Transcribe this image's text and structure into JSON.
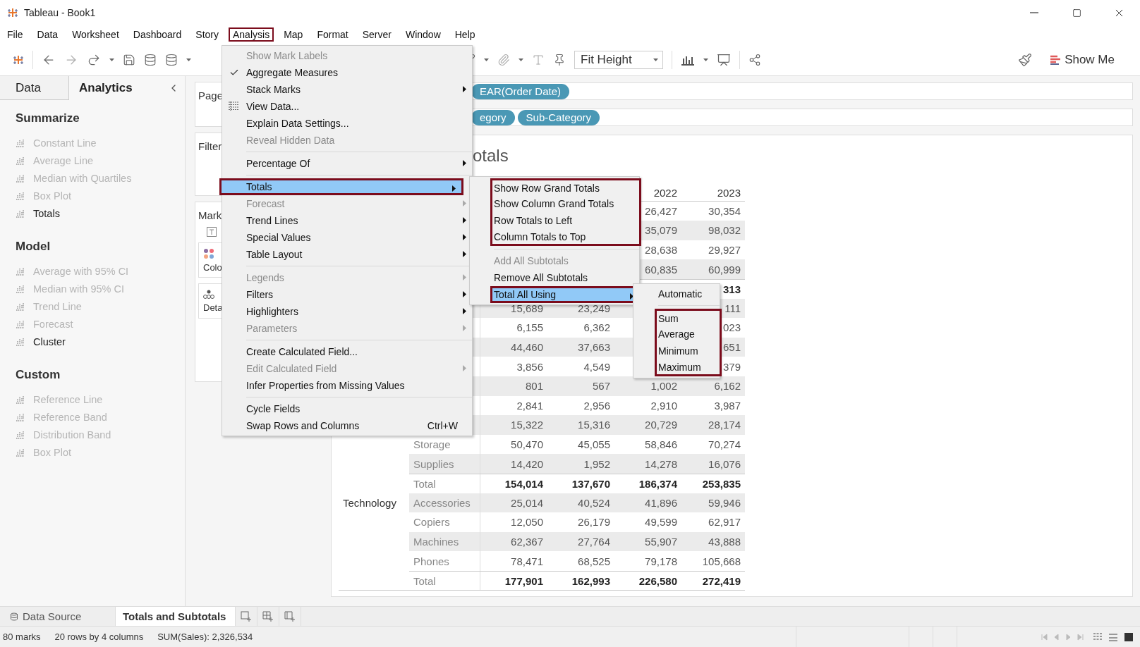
{
  "window": {
    "title": "Tableau - Book1"
  },
  "menu_bar": [
    {
      "label": "File",
      "framed": false
    },
    {
      "label": "Data",
      "framed": false
    },
    {
      "label": "Worksheet",
      "framed": false
    },
    {
      "label": "Dashboard",
      "framed": false
    },
    {
      "label": "Story",
      "framed": false
    },
    {
      "label": "Analysis",
      "framed": true
    },
    {
      "label": "Map",
      "framed": false
    },
    {
      "label": "Format",
      "framed": false
    },
    {
      "label": "Server",
      "framed": false
    },
    {
      "label": "Window",
      "framed": false
    },
    {
      "label": "Help",
      "framed": false
    }
  ],
  "toolbar": {
    "fit": "Fit Height",
    "show_me": "Show Me"
  },
  "side_tabs": [
    {
      "label": "Data",
      "selected": false
    },
    {
      "label": "Analytics",
      "selected": true
    }
  ],
  "analytics": [
    {
      "title": "Summarize",
      "items": [
        {
          "label": "Constant Line",
          "disabled": true
        },
        {
          "label": "Average Line",
          "disabled": true
        },
        {
          "label": "Median with Quartiles",
          "disabled": true
        },
        {
          "label": "Box Plot",
          "disabled": true
        },
        {
          "label": "Totals",
          "disabled": false
        }
      ]
    },
    {
      "title": "Model",
      "items": [
        {
          "label": "Average with 95% CI",
          "disabled": true
        },
        {
          "label": "Median with 95% CI",
          "disabled": true
        },
        {
          "label": "Trend Line",
          "disabled": true
        },
        {
          "label": "Forecast",
          "disabled": true
        },
        {
          "label": "Cluster",
          "disabled": false
        }
      ]
    },
    {
      "title": "Custom",
      "items": [
        {
          "label": "Reference Line",
          "disabled": true
        },
        {
          "label": "Reference Band",
          "disabled": true
        },
        {
          "label": "Distribution Band",
          "disabled": true
        },
        {
          "label": "Box Plot",
          "disabled": true
        }
      ]
    }
  ],
  "cards": {
    "pages": "Page",
    "filters": "Filter",
    "marks": "Mark",
    "mark_buttons": [
      "Colo",
      "Deta"
    ]
  },
  "columns_shelf": [
    "EAR(Order Date)"
  ],
  "rows_shelf": [
    "egory",
    "Sub-Category"
  ],
  "view": {
    "title": "otals",
    "header": {
      "column_3": "2022",
      "column_4": "2023"
    },
    "rows": [
      {
        "total": false,
        "shaded": false,
        "column_3": "26,427",
        "column_4": "30,354"
      },
      {
        "total": false,
        "shaded": true,
        "column_3": "35,079",
        "column_4": "98,032"
      },
      {
        "total": false,
        "shaded": false,
        "column_3": "28,638",
        "column_4": "29,927"
      },
      {
        "total": false,
        "shaded": true,
        "column_3": "60,835",
        "column_4": "60,999"
      },
      {
        "total": true,
        "shaded": false,
        "column_4": "313"
      },
      {
        "total": false,
        "shaded": true,
        "column_1": "15,689",
        "column_2": "23,249",
        "column_4": "111"
      },
      {
        "total": false,
        "shaded": false,
        "column_1": "6,155",
        "column_2": "6,362",
        "column_4": "023"
      },
      {
        "total": false,
        "shaded": true,
        "column_1": "44,460",
        "column_2": "37,663",
        "column_4": "651"
      },
      {
        "total": false,
        "shaded": false,
        "column_1": "3,856",
        "column_2": "4,549",
        "column_4": "379"
      },
      {
        "total": false,
        "shaded": true,
        "column_1": "801",
        "column_2": "567",
        "column_3": "1,002",
        "column_4": "6,162"
      },
      {
        "total": false,
        "shaded": false,
        "column_1": "2,841",
        "column_2": "2,956",
        "column_3": "2,910",
        "column_4": "3,987"
      },
      {
        "total": false,
        "shaded": true,
        "column_1": "15,322",
        "column_2": "15,316",
        "column_3": "20,729",
        "column_4": "28,174"
      },
      {
        "subcategory": "Storage",
        "total": false,
        "shaded": false,
        "column_1": "50,470",
        "column_2": "45,055",
        "column_3": "58,846",
        "column_4": "70,274"
      },
      {
        "subcategory": "Supplies",
        "total": false,
        "shaded": true,
        "column_1": "14,420",
        "column_2": "1,952",
        "column_3": "14,278",
        "column_4": "16,076"
      },
      {
        "subcategory": "Total",
        "total": true,
        "shaded": false,
        "column_1": "154,014",
        "column_2": "137,670",
        "column_3": "186,374",
        "column_4": "253,835"
      },
      {
        "category": "Technology",
        "subcategory": "Accessories",
        "total": false,
        "shaded": true,
        "column_1": "25,014",
        "column_2": "40,524",
        "column_3": "41,896",
        "column_4": "59,946"
      },
      {
        "subcategory": "Copiers",
        "total": false,
        "shaded": false,
        "column_1": "12,050",
        "column_2": "26,179",
        "column_3": "49,599",
        "column_4": "62,917"
      },
      {
        "subcategory": "Machines",
        "total": false,
        "shaded": true,
        "column_1": "62,367",
        "column_2": "27,764",
        "column_3": "55,907",
        "column_4": "43,888"
      },
      {
        "subcategory": "Phones",
        "total": false,
        "shaded": false,
        "column_1": "78,471",
        "column_2": "68,525",
        "column_3": "79,178",
        "column_4": "105,668"
      },
      {
        "subcategory": "Total",
        "total": true,
        "shaded": false,
        "column_1": "177,901",
        "column_2": "162,993",
        "column_3": "226,580",
        "column_4": "272,419"
      }
    ]
  },
  "analysis_menu": [
    [
      {
        "label": "Show Mark Labels",
        "disabled": true,
        "checked": false,
        "submenu": false,
        "highlighted": false
      },
      {
        "label": "Aggregate Measures",
        "disabled": false,
        "checked": true,
        "submenu": false,
        "highlighted": false
      },
      {
        "label": "Stack Marks",
        "disabled": false,
        "checked": false,
        "submenu": true,
        "highlighted": false
      },
      {
        "label": "View Data...",
        "disabled": false,
        "checked": false,
        "submenu": false,
        "highlighted": false,
        "icon": true
      },
      {
        "label": "Explain Data Settings...",
        "disabled": false,
        "checked": false,
        "submenu": false,
        "highlighted": false
      },
      {
        "label": "Reveal Hidden Data",
        "disabled": true,
        "checked": false,
        "submenu": false,
        "highlighted": false
      }
    ],
    [
      {
        "label": "Percentage Of",
        "disabled": false,
        "checked": false,
        "submenu": true,
        "highlighted": false
      }
    ],
    [
      {
        "label": "Totals",
        "disabled": false,
        "checked": false,
        "submenu": true,
        "highlighted": true,
        "framed": true
      },
      {
        "label": "Forecast",
        "disabled": true,
        "checked": false,
        "submenu": true,
        "highlighted": false
      },
      {
        "label": "Trend Lines",
        "disabled": false,
        "checked": false,
        "submenu": true,
        "highlighted": false
      },
      {
        "label": "Special Values",
        "disabled": false,
        "checked": false,
        "submenu": true,
        "highlighted": false
      },
      {
        "label": "Table Layout",
        "disabled": false,
        "checked": false,
        "submenu": true,
        "highlighted": false
      }
    ],
    [
      {
        "label": "Legends",
        "disabled": true,
        "checked": false,
        "submenu": true,
        "highlighted": false
      },
      {
        "label": "Filters",
        "disabled": false,
        "checked": false,
        "submenu": true,
        "highlighted": false
      },
      {
        "label": "Highlighters",
        "disabled": false,
        "checked": false,
        "submenu": true,
        "highlighted": false
      },
      {
        "label": "Parameters",
        "disabled": true,
        "checked": false,
        "submenu": true,
        "highlighted": false
      }
    ],
    [
      {
        "label": "Create Calculated Field...",
        "disabled": false,
        "checked": false,
        "submenu": false,
        "highlighted": false
      },
      {
        "label": "Edit Calculated Field",
        "disabled": true,
        "checked": false,
        "submenu": true,
        "highlighted": false
      },
      {
        "label": "Infer Properties from Missing Values",
        "disabled": false,
        "checked": false,
        "submenu": false,
        "highlighted": false
      }
    ],
    [
      {
        "label": "Cycle Fields",
        "disabled": false,
        "checked": false,
        "submenu": false,
        "highlighted": false
      },
      {
        "label": "Swap Rows and Columns",
        "shortcut": "Ctrl+W",
        "disabled": false,
        "checked": false,
        "submenu": false,
        "highlighted": false
      }
    ]
  ],
  "totals_menu": [
    [
      {
        "label": "Show Row Grand Totals",
        "disabled": false,
        "submenu": false,
        "highlighted": false,
        "framed": true
      },
      {
        "label": "Show Column Grand Totals",
        "disabled": false,
        "submenu": false,
        "highlighted": false,
        "framed": true
      },
      {
        "label": "Row Totals to Left",
        "disabled": false,
        "submenu": false,
        "highlighted": false,
        "framed": true
      },
      {
        "label": "Column Totals to Top",
        "disabled": false,
        "submenu": false,
        "highlighted": false,
        "framed": true
      }
    ],
    [
      {
        "label": "Add All Subtotals",
        "disabled": true,
        "submenu": false,
        "highlighted": false
      },
      {
        "label": "Remove All Subtotals",
        "disabled": false,
        "submenu": false,
        "highlighted": false
      },
      {
        "label": "Total All Using",
        "disabled": false,
        "submenu": true,
        "highlighted": true,
        "framed": true
      }
    ]
  ],
  "total_using_menu": [
    [
      {
        "label": "Automatic",
        "disabled": false,
        "submenu": false,
        "highlighted": false
      }
    ],
    [
      {
        "label": "Sum",
        "disabled": false,
        "submenu": false,
        "highlighted": false,
        "framed": true
      },
      {
        "label": "Average",
        "disabled": false,
        "submenu": false,
        "highlighted": false,
        "framed": true
      },
      {
        "label": "Minimum",
        "disabled": false,
        "submenu": false,
        "highlighted": false,
        "framed": true
      },
      {
        "label": "Maximum",
        "disabled": false,
        "submenu": false,
        "highlighted": false,
        "framed": true
      }
    ]
  ],
  "sheet_tabs": [
    {
      "label": "Data Source",
      "selected": false
    },
    {
      "label": "Totals and Subtotals",
      "selected": true
    }
  ],
  "status_bar": [
    "80 marks",
    "20 rows by 4 columns",
    "SUM(Sales): 2,326,534"
  ]
}
